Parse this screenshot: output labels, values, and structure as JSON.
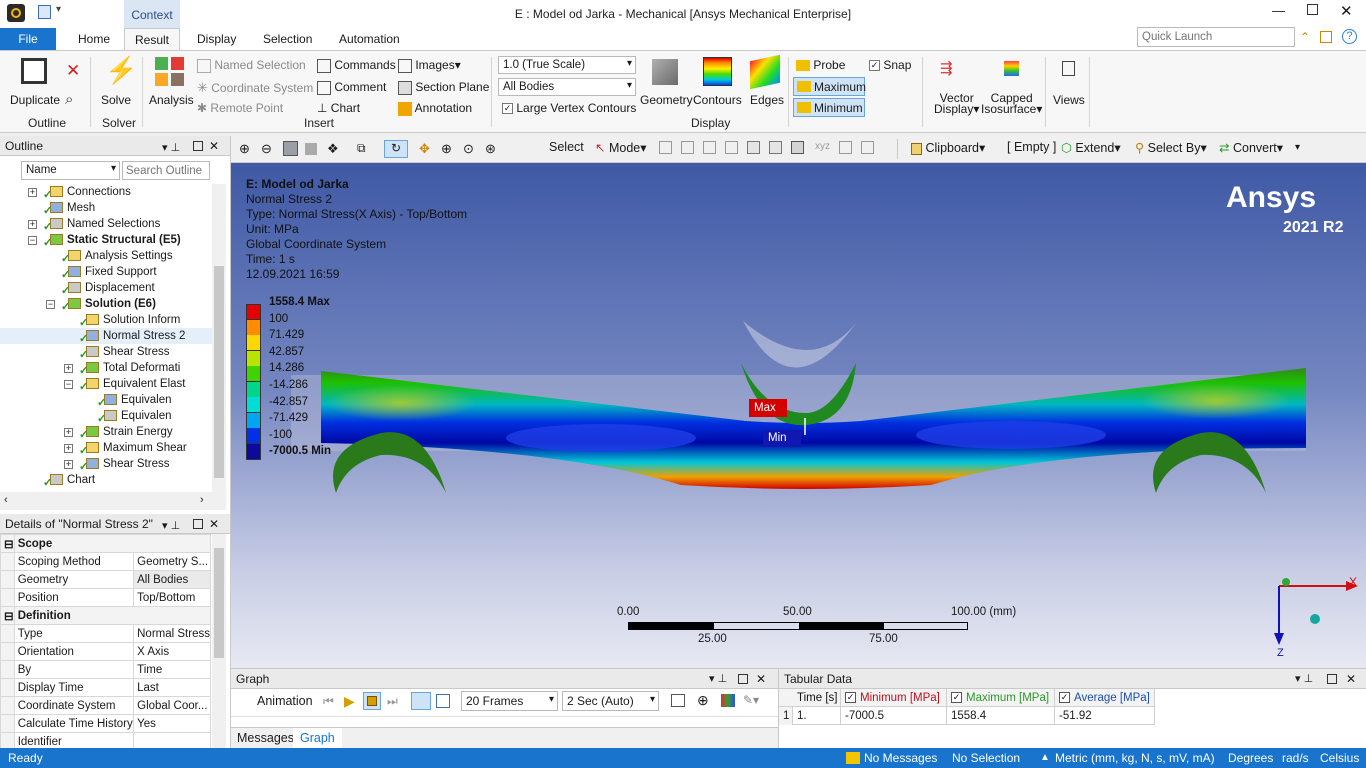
{
  "window": {
    "title": "E : Model od Jarka - Mechanical [Ansys Mechanical Enterprise]",
    "context_tab": "Context"
  },
  "tabs": [
    "File",
    "Home",
    "Result",
    "Display",
    "Selection",
    "Automation"
  ],
  "quick_launch_placeholder": "Quick Launch",
  "ribbon": {
    "outline": {
      "duplicate": "Duplicate",
      "group": "Outline"
    },
    "solver": {
      "solve": "Solve",
      "group": "Solver"
    },
    "insert": {
      "analysis": "Analysis",
      "named_selection": "Named Selection",
      "coordinate_system": "Coordinate System",
      "remote_point": "Remote Point",
      "commands": "Commands",
      "comment": "Comment",
      "chart": "Chart",
      "images": "Images",
      "section_plane": "Section Plane",
      "annotation": "Annotation",
      "group": "Insert"
    },
    "display": {
      "scale": "1.0 (True Scale)",
      "bodies": "All Bodies",
      "large_vertex": "Large Vertex Contours",
      "geometry": "Geometry",
      "contours": "Contours",
      "edges": "Edges",
      "group": "Display"
    },
    "probe": "Probe",
    "snap": "Snap",
    "maximum": "Maximum",
    "minimum": "Minimum",
    "vector_display": [
      "Vector",
      "Display"
    ],
    "capped_isosurface": [
      "Capped",
      "Isosurface"
    ],
    "views": "Views"
  },
  "graphics_toolbar": {
    "select": "Select",
    "mode": "Mode",
    "clipboard": "Clipboard",
    "empty": "[ Empty ]",
    "extend": "Extend",
    "select_by": "Select By",
    "convert": "Convert"
  },
  "outline": {
    "title": "Outline",
    "name_label": "Name",
    "search_placeholder": "Search Outline",
    "items": [
      {
        "label": "Connections",
        "indent": 1,
        "bold": false
      },
      {
        "label": "Mesh",
        "indent": 1,
        "bold": false
      },
      {
        "label": "Named Selections",
        "indent": 1,
        "bold": false
      },
      {
        "label": "Static Structural (E5)",
        "indent": 1,
        "bold": true
      },
      {
        "label": "Analysis Settings",
        "indent": 2,
        "bold": false
      },
      {
        "label": "Fixed Support",
        "indent": 2,
        "bold": false
      },
      {
        "label": "Displacement",
        "indent": 2,
        "bold": false
      },
      {
        "label": "Solution (E6)",
        "indent": 2,
        "bold": true
      },
      {
        "label": "Solution Inform",
        "indent": 3,
        "bold": false
      },
      {
        "label": "Normal Stress 2",
        "indent": 3,
        "bold": false
      },
      {
        "label": "Shear Stress",
        "indent": 3,
        "bold": false
      },
      {
        "label": "Total Deformati",
        "indent": 3,
        "bold": false
      },
      {
        "label": "Equivalent Elast",
        "indent": 3,
        "bold": false
      },
      {
        "label": "Equivalen",
        "indent": 4,
        "bold": false
      },
      {
        "label": "Equivalen",
        "indent": 4,
        "bold": false
      },
      {
        "label": "Strain Energy",
        "indent": 3,
        "bold": false
      },
      {
        "label": "Maximum Shear",
        "indent": 3,
        "bold": false
      },
      {
        "label": "Shear Stress",
        "indent": 3,
        "bold": false
      },
      {
        "label": "Chart",
        "indent": 1,
        "bold": false
      }
    ]
  },
  "details": {
    "title": "Details of \"Normal Stress 2\"",
    "rows": [
      {
        "section": "Scope"
      },
      {
        "k": "Scoping Method",
        "v": "Geometry S..."
      },
      {
        "k": "Geometry",
        "v": "All Bodies"
      },
      {
        "k": "Position",
        "v": "Top/Bottom"
      },
      {
        "section": "Definition"
      },
      {
        "k": "Type",
        "v": "Normal Stress"
      },
      {
        "k": "Orientation",
        "v": "X Axis"
      },
      {
        "k": "By",
        "v": "Time"
      },
      {
        "k": "Display Time",
        "v": "Last"
      },
      {
        "k": "Coordinate System",
        "v": "Global Coor..."
      },
      {
        "k": "Calculate Time History",
        "v": "Yes"
      },
      {
        "k": "Identifier",
        "v": ""
      }
    ]
  },
  "viewport": {
    "model": "E: Model od Jarka",
    "result": "Normal Stress 2",
    "type": "Type: Normal Stress(X Axis) - Top/Bottom",
    "unit": "Unit: MPa",
    "cs": "Global Coordinate System",
    "time": "Time: 1 s",
    "date": "12.09.2021 16:59",
    "brand": "Ansys",
    "version": "2021 R2",
    "max_tag": "Max",
    "min_tag": "Min",
    "axis_x": "X",
    "axis_z": "Z",
    "legend": [
      {
        "label": "1558.4 Max",
        "color": "#e50000",
        "bold": true
      },
      {
        "label": "100",
        "color": "#ff8c00",
        "bold": false
      },
      {
        "label": "71.429",
        "color": "#ffd700",
        "bold": false
      },
      {
        "label": "42.857",
        "color": "#b8e400",
        "bold": false
      },
      {
        "label": "14.286",
        "color": "#3fd300",
        "bold": false
      },
      {
        "label": "-14.286",
        "color": "#00d58b",
        "bold": false
      },
      {
        "label": "-42.857",
        "color": "#00dcd6",
        "bold": false
      },
      {
        "label": "-71.429",
        "color": "#00a7f0",
        "bold": false
      },
      {
        "label": "-100",
        "color": "#0030e8",
        "bold": false
      },
      {
        "label": "-7000.5 Min",
        "color": "#0a0a9c",
        "bold": true
      }
    ],
    "scale_labels_top": [
      "0.00",
      "50.00",
      "100.00 (mm)"
    ],
    "scale_labels_bottom": [
      "25.00",
      "75.00"
    ]
  },
  "graph": {
    "title": "Graph",
    "animation": "Animation",
    "frames": "20 Frames",
    "duration": "2 Sec (Auto)",
    "bottom_tabs": [
      "Messages",
      "Graph"
    ]
  },
  "tabular": {
    "title": "Tabular Data",
    "headers": [
      "Time [s]",
      "Minimum [MPa]",
      "Maximum [MPa]",
      "Average [MPa]"
    ],
    "header_colors": [
      "#111111",
      "#c0101a",
      "#2a9a2a",
      "#1a4fb0"
    ],
    "rows": [
      [
        "1",
        "1.",
        "-7000.5",
        "1558.4",
        "-51.92"
      ]
    ]
  },
  "status": {
    "ready": "Ready",
    "messages": "No Messages",
    "selection": "No Selection",
    "units": "Metric (mm, kg, N, s, mV, mA)",
    "angle": "Degrees",
    "rate": "rad/s",
    "temp": "Celsius"
  }
}
